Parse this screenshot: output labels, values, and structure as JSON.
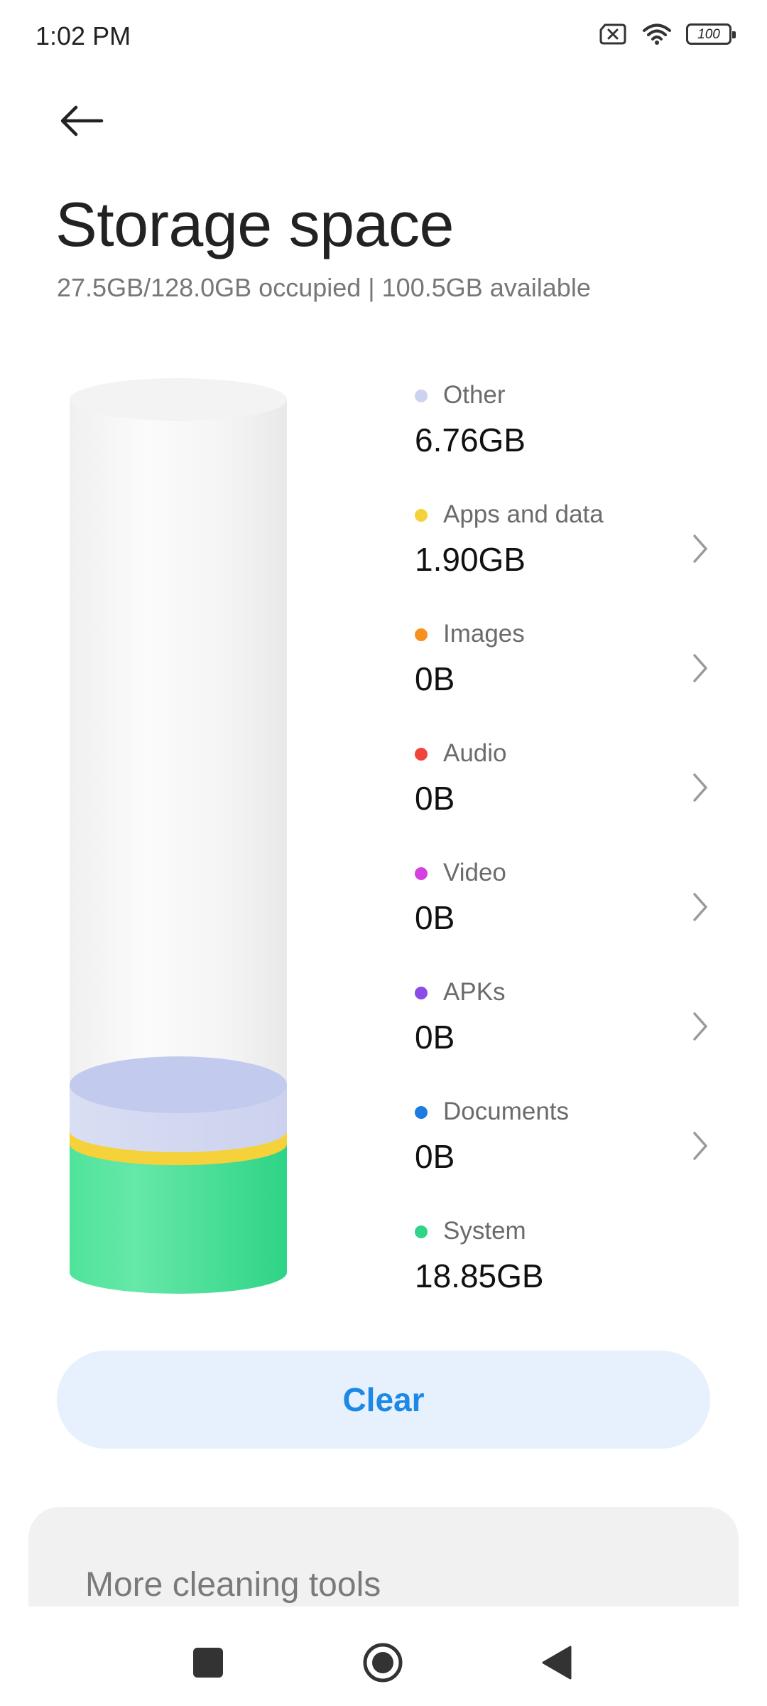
{
  "status_bar": {
    "time": "1:02 PM",
    "battery": "100"
  },
  "header": {
    "title": "Storage space",
    "subtitle": "27.5GB/128.0GB occupied | 100.5GB available"
  },
  "storage": {
    "used_gb": 27.5,
    "total_gb": 128.0,
    "segments": [
      {
        "name": "Other",
        "gb": 6.76,
        "color": "#d4daf2"
      },
      {
        "name": "Apps and data",
        "gb": 1.9,
        "color": "#f5d23a"
      },
      {
        "name": "System",
        "gb": 18.85,
        "color": "#3ddc8a"
      }
    ]
  },
  "legend": [
    {
      "label": "Other",
      "value": "6.76GB",
      "color": "#ccd3ee",
      "chevron": false
    },
    {
      "label": "Apps and data",
      "value": "1.90GB",
      "color": "#f5d23a",
      "chevron": true
    },
    {
      "label": "Images",
      "value": "0B",
      "color": "#f5921e",
      "chevron": true
    },
    {
      "label": "Audio",
      "value": "0B",
      "color": "#f0433a",
      "chevron": true
    },
    {
      "label": "Video",
      "value": "0B",
      "color": "#d63fe0",
      "chevron": true
    },
    {
      "label": "APKs",
      "value": "0B",
      "color": "#8a4be6",
      "chevron": true
    },
    {
      "label": "Documents",
      "value": "0B",
      "color": "#1e7be0",
      "chevron": true
    },
    {
      "label": "System",
      "value": "18.85GB",
      "color": "#2fd486",
      "chevron": false
    }
  ],
  "actions": {
    "clear_label": "Clear"
  },
  "tools": {
    "title": "More cleaning tools"
  },
  "nav": {
    "icons": [
      "recents-square-icon",
      "home-circle-icon",
      "back-triangle-icon"
    ]
  }
}
